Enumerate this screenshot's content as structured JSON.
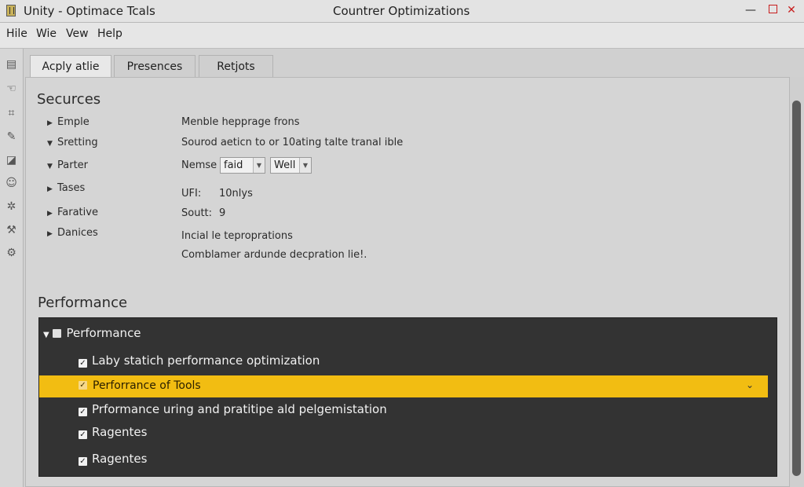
{
  "titlebar": {
    "app_title": "Unity - Optimace Tcals",
    "window_title": "Countrer Optimizations",
    "minimize": "—",
    "close": "✕"
  },
  "menu": [
    "Hile",
    "Wie",
    "Vew",
    "Help"
  ],
  "left_tools": [
    "layers-icon",
    "hand-icon",
    "tag-icon",
    "pencil-icon",
    "terminal-icon",
    "smile-icon",
    "gear-icon",
    "wrench-icon",
    "settings-icon"
  ],
  "tabs": [
    "Acply atlie",
    "Presences",
    "Retjots"
  ],
  "securces": {
    "title": "Securces",
    "items": [
      "Emple",
      "Sretting",
      "Parter",
      "Tases",
      "Farative",
      "Danices"
    ]
  },
  "props": {
    "line1": "Menble hepprage frons",
    "line2": "Sourod aeticn to or 10ating talte tranal ible",
    "nemse_label": "Nemse",
    "select1": "faid",
    "select2": "Well",
    "ufi_label": "UFI:",
    "ufi_value": "10nlys",
    "sout_label": "Soutt:",
    "sout_value": "9",
    "line3": "Incial le teproprations",
    "line4": "Comblamer ardunde decpration lie!."
  },
  "performance": {
    "section_title": "Performance",
    "group_label": "Performance",
    "rows": [
      "Laby statich performance optimization",
      "Perforrance of Tools",
      "Prformance uring and pratitipe ald pelgemistation",
      "Ragentes",
      "Ragentes"
    ],
    "highlight_color": "#f2bd12"
  }
}
